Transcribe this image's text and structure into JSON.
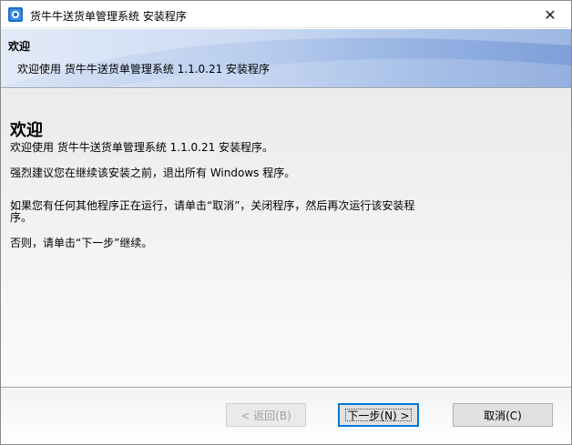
{
  "window": {
    "title": "货牛牛送货单管理系统 安装程序",
    "close_glyph": "✕"
  },
  "header": {
    "title": "欢迎",
    "subtitle": "欢迎使用 货牛牛送货单管理系统 1.1.0.21 安装程序"
  },
  "main": {
    "heading": "欢迎",
    "paragraphs": [
      "欢迎使用 货牛牛送货单管理系统 1.1.0.21 安装程序。",
      "强烈建议您在继续该安装之前，退出所有 Windows 程序。",
      "如果您有任何其他程序正在运行，请单击“取消”，关闭程序，然后再次运行该安装程",
      "序。",
      "否则，请单击“下一步”继续。"
    ]
  },
  "buttons": {
    "back": "< 返回(B)",
    "next": "下一步(N) >",
    "cancel": "取消(C)"
  },
  "icons": {
    "app": "installer-app-icon",
    "close": "close-icon"
  },
  "colors": {
    "accent": "#0078d7",
    "header_light": "#d9e4f6",
    "header_dark": "#7e9fd8"
  }
}
